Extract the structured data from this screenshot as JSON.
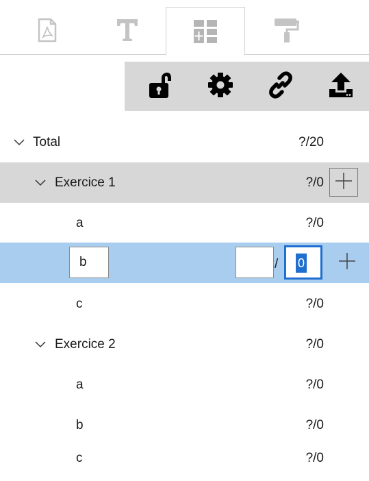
{
  "tabs": [
    {
      "name": "pdf-document-icon",
      "active": false
    },
    {
      "name": "text-icon",
      "active": false
    },
    {
      "name": "grading-layout-icon",
      "active": true
    },
    {
      "name": "paint-roller-icon",
      "active": false
    }
  ],
  "toolbar": {
    "icons": [
      "unlock-icon",
      "gear-icon",
      "link-icon",
      "upload-icon"
    ]
  },
  "tree": {
    "total": {
      "label": "Total",
      "score": "?/20"
    },
    "exercise1": {
      "label": "Exercice 1",
      "score": "?/0",
      "items": [
        {
          "label": "a",
          "score": "?/0"
        },
        {
          "label": "b",
          "score_value": "",
          "slash": "/",
          "max_value": "0"
        },
        {
          "label": "c",
          "score": "?/0"
        }
      ]
    },
    "exercise2": {
      "label": "Exercice 2",
      "score": "?/0",
      "items": [
        {
          "label": "a",
          "score": "?/0"
        },
        {
          "label": "b",
          "score": "?/0"
        },
        {
          "label": "c",
          "score": "?/0"
        }
      ]
    }
  },
  "colors": {
    "selected_row": "#a9cdee",
    "group_row": "#d7d7d7",
    "focus_border": "#1e6fd0"
  }
}
